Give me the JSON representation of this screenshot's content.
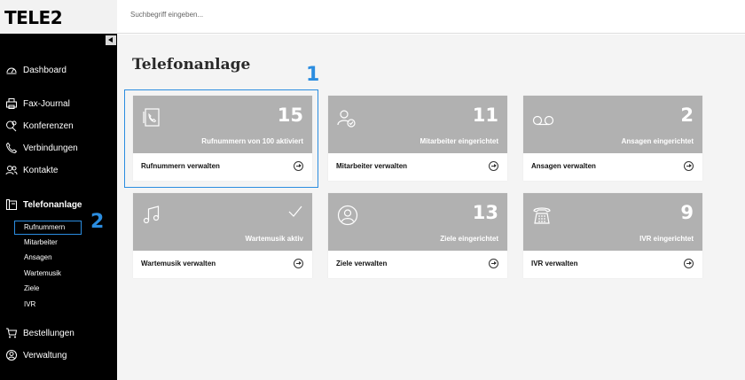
{
  "brand": {
    "logo_text": "TELE2"
  },
  "search": {
    "placeholder": "Suchbegriff eingeben..."
  },
  "sidebar": {
    "items": [
      {
        "label": "Dashboard",
        "icon": "dashboard-icon"
      },
      {
        "label": "Fax-Journal",
        "icon": "fax-icon"
      },
      {
        "label": "Konferenzen",
        "icon": "conference-icon"
      },
      {
        "label": "Verbindungen",
        "icon": "phone-icon"
      },
      {
        "label": "Kontakte",
        "icon": "contacts-icon"
      },
      {
        "label": "Telefonanlage",
        "icon": "pbx-icon"
      },
      {
        "label": "Bestellungen",
        "icon": "cart-icon"
      },
      {
        "label": "Verwaltung",
        "icon": "admin-icon"
      }
    ],
    "subitems": [
      "Rufnummern",
      "Mitarbeiter",
      "Ansagen",
      "Wartemusik",
      "Ziele",
      "IVR"
    ]
  },
  "main": {
    "title": "Telefonanlage",
    "cards": [
      {
        "number": "15",
        "subtitle": "Rufnummern von 100 aktiviert",
        "link": "Rufnummern verwalten",
        "icon": "phonebook-icon"
      },
      {
        "number": "11",
        "subtitle": "Mitarbeiter eingerichtet",
        "link": "Mitarbeiter verwalten",
        "icon": "user-check-icon"
      },
      {
        "number": "2",
        "subtitle": "Ansagen eingerichtet",
        "link": "Ansagen verwalten",
        "icon": "voicemail-icon"
      },
      {
        "number": "",
        "subtitle": "Wartemusik aktiv",
        "link": "Wartemusik verwalten",
        "icon": "music-note-icon"
      },
      {
        "number": "13",
        "subtitle": "Ziele eingerichtet",
        "link": "Ziele verwalten",
        "icon": "target-user-icon"
      },
      {
        "number": "9",
        "subtitle": "IVR eingerichtet",
        "link": "IVR verwalten",
        "icon": "desk-phone-icon"
      }
    ]
  },
  "annotations": {
    "one": "1",
    "two": "2"
  },
  "colors": {
    "sidebar_bg": "#000000",
    "card_header": "#b1b1b1",
    "annotation": "#2b8de0"
  }
}
